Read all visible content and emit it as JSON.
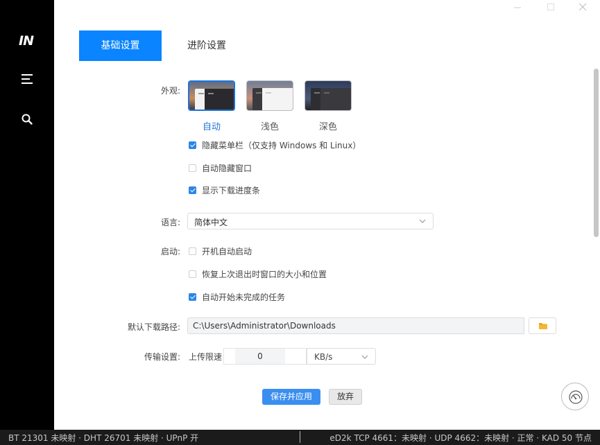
{
  "sidebar": {
    "logo": "IN",
    "icons": [
      "menu-icon",
      "search-icon"
    ]
  },
  "tabs": [
    {
      "label": "基础设置",
      "active": true
    },
    {
      "label": "进阶设置",
      "active": false
    }
  ],
  "appearance": {
    "label": "外观:",
    "themes": [
      {
        "label": "自动",
        "selected": true
      },
      {
        "label": "浅色",
        "selected": false
      },
      {
        "label": "深色",
        "selected": false
      }
    ],
    "options": [
      {
        "label": "隐藏菜单栏（仅支持 Windows 和 Linux）",
        "checked": true
      },
      {
        "label": "自动隐藏窗口",
        "checked": false
      },
      {
        "label": "显示下载进度条",
        "checked": true
      }
    ]
  },
  "language": {
    "label": "语言:",
    "value": "简体中文"
  },
  "startup": {
    "label": "启动:",
    "options": [
      {
        "label": "开机自动启动",
        "checked": false
      },
      {
        "label": "恢复上次退出时窗口的大小和位置",
        "checked": false
      },
      {
        "label": "自动开始未完成的任务",
        "checked": true
      }
    ]
  },
  "download_path": {
    "label": "默认下载路径:",
    "value": "C:\\Users\\Administrator\\Downloads"
  },
  "transfer": {
    "label": "传输设置:",
    "upload_label": "上传限速",
    "upload_value": "0",
    "unit": "KB/s"
  },
  "actions": {
    "save": "保存并应用",
    "discard": "放弃"
  },
  "status": {
    "left": "BT 21301 未映射 · DHT 26701 未映射 · UPnP 开",
    "right": "eD2k TCP 4661：未映射 · UDP 4662：未映射 · 正常 · KAD 50 节点"
  },
  "colors": {
    "accent": "#0a84ff",
    "sidebar_bg": "#000000",
    "status_bg": "#1b1b1b"
  }
}
